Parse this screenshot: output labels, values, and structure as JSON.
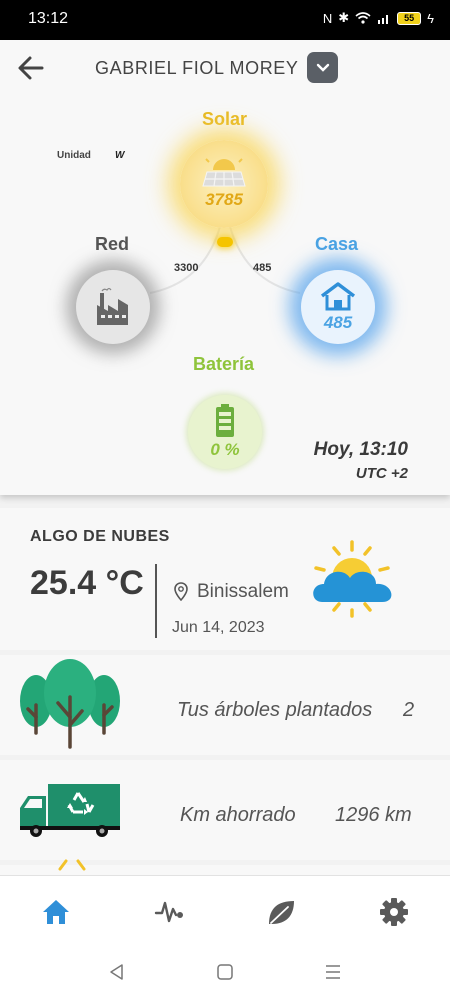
{
  "status_bar": {
    "time": "13:12",
    "battery": "55"
  },
  "header": {
    "user_name": "GABRIEL FIOL MOREY"
  },
  "energy": {
    "unit_label": "Unidad",
    "unit_value": "W",
    "solar": {
      "label": "Solar",
      "value": "3785"
    },
    "grid": {
      "label": "Red"
    },
    "home": {
      "label": "Casa",
      "value": "485"
    },
    "battery": {
      "label": "Batería",
      "value": "0 %"
    },
    "flow_grid_value": "3300",
    "flow_home_value": "485",
    "timestamp": "Hoy, 13:10",
    "timezone": "UTC +2"
  },
  "weather": {
    "condition": "ALGO DE NUBES",
    "temperature": "25.4 °C",
    "location": "Binissalem",
    "date": "Jun 14, 2023"
  },
  "stats": {
    "trees_label": "Tus árboles plantados",
    "trees_value": "2",
    "km_label": "Km ahorrado",
    "km_value": "1296 km"
  },
  "nav": {
    "items": [
      {
        "icon": "home-icon",
        "active": true
      },
      {
        "icon": "activity-icon",
        "active": false
      },
      {
        "icon": "leaf-icon",
        "active": false
      },
      {
        "icon": "gear-icon",
        "active": false
      }
    ]
  },
  "colors": {
    "solar": "#e7b923",
    "home": "#4aa3e3",
    "battery": "#8fc43c",
    "nav_active": "#2f8fd8",
    "nav_inactive": "#5a5a5a"
  }
}
